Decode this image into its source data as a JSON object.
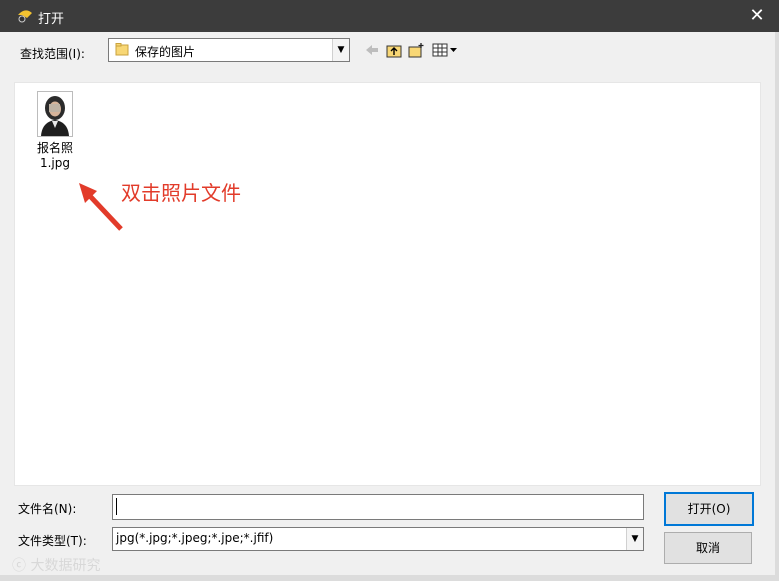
{
  "window": {
    "title": "打开",
    "close_glyph": "✕"
  },
  "toolbar": {
    "look_in_label": "查找范围(I):",
    "look_in_value": "保存的图片",
    "icons": [
      "back-arrow-icon",
      "up-folder-icon",
      "new-folder-icon",
      "view-menu-icon"
    ]
  },
  "files": [
    {
      "name": "报名照\n1.jpg"
    }
  ],
  "annotation": {
    "text": "双击照片文件",
    "color": "#e23b2a"
  },
  "form": {
    "filename_label": "文件名(N):",
    "filename_value": "",
    "filetype_label": "文件类型(T):",
    "filetype_value": "jpg(*.jpg;*.jpeg;*.jpe;*.jfif)"
  },
  "buttons": {
    "open": "打开(O)",
    "cancel": "取消"
  },
  "watermark": "大数据研究",
  "colors": {
    "titlebar": "#3c3c3c",
    "focus": "#0078d7"
  }
}
